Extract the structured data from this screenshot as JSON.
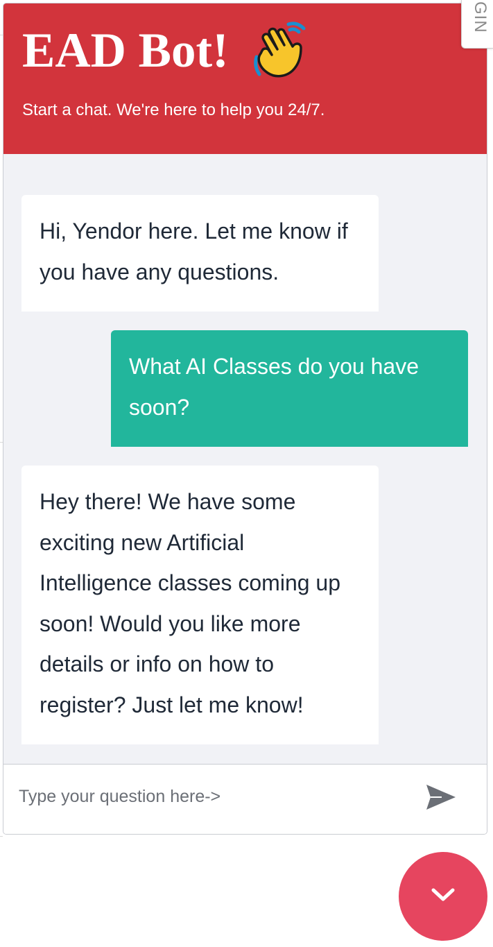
{
  "header": {
    "title": "EAD Bot!",
    "title_icon": "waving-hand-icon",
    "subtitle": "Start a chat. We're here to help you 24/7."
  },
  "side_tab": {
    "label": "GIN"
  },
  "messages": [
    {
      "sender": "bot",
      "text": "Hi, Yendor here. Let me know if you have any questions."
    },
    {
      "sender": "user",
      "text": "What AI Classes do you have soon?"
    },
    {
      "sender": "bot",
      "text": "Hey there! We have some exciting new Artificial Intelligence classes coming up soon! Would you like more details or info on how to register? Just let me know!"
    }
  ],
  "composer": {
    "placeholder": "Type your question here->",
    "value": "",
    "send_icon": "send-icon"
  },
  "launcher": {
    "icon": "chevron-down-icon"
  },
  "colors": {
    "header_bg": "#d2343c",
    "user_bubble": "#22b69c",
    "bot_bubble": "#ffffff",
    "chat_bg": "#f1f2f6",
    "launcher_bg": "#e6455f"
  }
}
